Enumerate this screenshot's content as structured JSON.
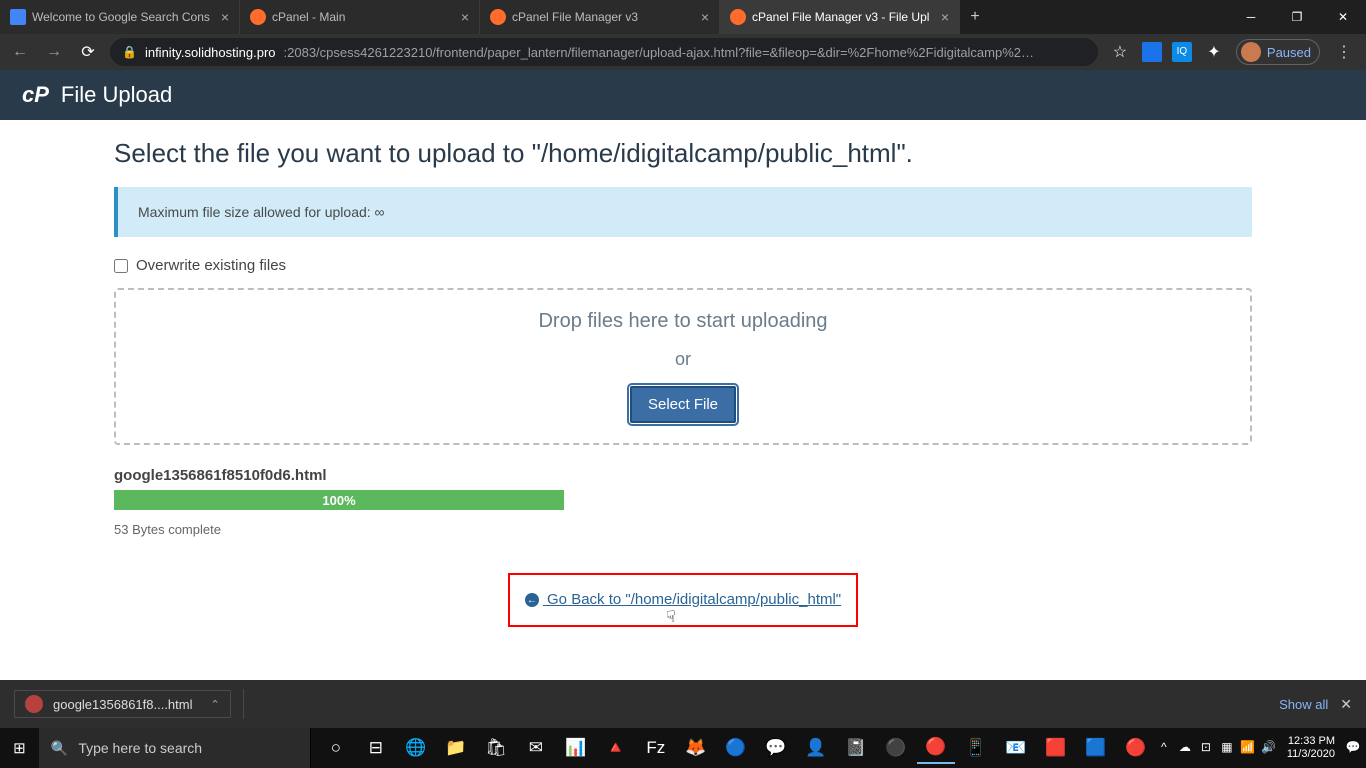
{
  "browser": {
    "tabs": [
      {
        "title": "Welcome to Google Search Cons"
      },
      {
        "title": "cPanel - Main"
      },
      {
        "title": "cPanel File Manager v3"
      },
      {
        "title": "cPanel File Manager v3 - File Upl"
      }
    ],
    "url_host": "infinity.solidhosting.pro",
    "url_path": ":2083/cpsess4261223210/frontend/paper_lantern/filemanager/upload-ajax.html?file=&fileop=&dir=%2Fhome%2Fidigitalcamp%2…",
    "paused": "Paused"
  },
  "header": {
    "title": "File Upload"
  },
  "content": {
    "heading": "Select the file you want to upload to \"/home/idigitalcamp/public_html\".",
    "info": "Maximum file size allowed for upload: ∞",
    "overwrite": "Overwrite existing files",
    "dropzone": {
      "lead": "Drop files here to start uploading",
      "or": "or",
      "select": "Select File"
    },
    "upload": {
      "name": "google1356861f8510f0d6.html",
      "percent": "100%",
      "status": "53 Bytes complete"
    },
    "goback": "Go Back to \"/home/idigitalcamp/public_html\""
  },
  "download": {
    "file": "google1356861f8....html",
    "showall": "Show all"
  },
  "taskbar": {
    "search": "Type here to search",
    "time": "12:33 PM",
    "date": "11/3/2020"
  }
}
